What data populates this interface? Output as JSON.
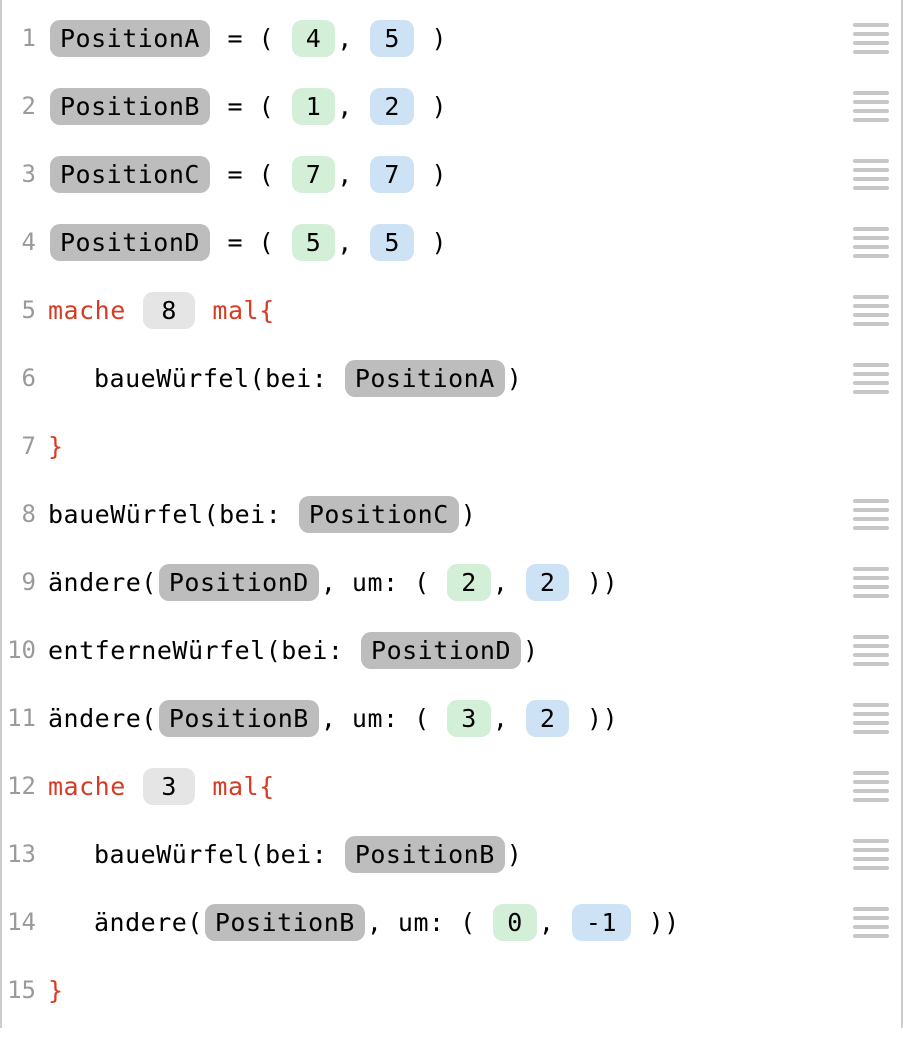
{
  "lines": [
    {
      "n": 1,
      "drag": true,
      "indent": 0,
      "tokens": [
        {
          "k": "var",
          "v": "PositionA"
        },
        {
          "k": "plain",
          "v": " = ( "
        },
        {
          "k": "pill",
          "c": "green",
          "v": "4"
        },
        {
          "k": "plain",
          "v": ", "
        },
        {
          "k": "pill",
          "c": "blue",
          "v": "5"
        },
        {
          "k": "plain",
          "v": " )"
        }
      ]
    },
    {
      "n": 2,
      "drag": true,
      "indent": 0,
      "tokens": [
        {
          "k": "var",
          "v": "PositionB"
        },
        {
          "k": "plain",
          "v": " = ( "
        },
        {
          "k": "pill",
          "c": "green",
          "v": "1"
        },
        {
          "k": "plain",
          "v": ", "
        },
        {
          "k": "pill",
          "c": "blue",
          "v": "2"
        },
        {
          "k": "plain",
          "v": " )"
        }
      ]
    },
    {
      "n": 3,
      "drag": true,
      "indent": 0,
      "tokens": [
        {
          "k": "var",
          "v": "PositionC"
        },
        {
          "k": "plain",
          "v": " = ( "
        },
        {
          "k": "pill",
          "c": "green",
          "v": "7"
        },
        {
          "k": "plain",
          "v": ", "
        },
        {
          "k": "pill",
          "c": "blue",
          "v": "7"
        },
        {
          "k": "plain",
          "v": " )"
        }
      ]
    },
    {
      "n": 4,
      "drag": true,
      "indent": 0,
      "tokens": [
        {
          "k": "var",
          "v": "PositionD"
        },
        {
          "k": "plain",
          "v": " = ( "
        },
        {
          "k": "pill",
          "c": "green",
          "v": "5"
        },
        {
          "k": "plain",
          "v": ", "
        },
        {
          "k": "pill",
          "c": "blue",
          "v": "5"
        },
        {
          "k": "plain",
          "v": " )"
        }
      ]
    },
    {
      "n": 5,
      "drag": true,
      "indent": 0,
      "tokens": [
        {
          "k": "kw",
          "v": "mache "
        },
        {
          "k": "pill",
          "c": "grey",
          "v": "8"
        },
        {
          "k": "kw",
          "v": " mal{"
        }
      ]
    },
    {
      "n": 6,
      "drag": true,
      "indent": 1,
      "tokens": [
        {
          "k": "plain",
          "v": "baueWürfel(bei: "
        },
        {
          "k": "var",
          "v": "PositionA"
        },
        {
          "k": "plain",
          "v": ")"
        }
      ]
    },
    {
      "n": 7,
      "drag": false,
      "indent": 0,
      "tokens": [
        {
          "k": "kw",
          "v": "}"
        }
      ]
    },
    {
      "n": 8,
      "drag": true,
      "indent": 0,
      "tokens": [
        {
          "k": "plain",
          "v": "baueWürfel(bei: "
        },
        {
          "k": "var",
          "v": "PositionC"
        },
        {
          "k": "plain",
          "v": ")"
        }
      ]
    },
    {
      "n": 9,
      "drag": true,
      "indent": 0,
      "tokens": [
        {
          "k": "plain",
          "v": "ändere("
        },
        {
          "k": "var",
          "v": "PositionD"
        },
        {
          "k": "plain",
          "v": ", um: ( "
        },
        {
          "k": "pill",
          "c": "green",
          "v": "2"
        },
        {
          "k": "plain",
          "v": ", "
        },
        {
          "k": "pill",
          "c": "blue",
          "v": "2"
        },
        {
          "k": "plain",
          "v": " ))"
        }
      ]
    },
    {
      "n": 10,
      "drag": true,
      "indent": 0,
      "tokens": [
        {
          "k": "plain",
          "v": "entferneWürfel(bei: "
        },
        {
          "k": "var",
          "v": "PositionD"
        },
        {
          "k": "plain",
          "v": ")"
        }
      ]
    },
    {
      "n": 11,
      "drag": true,
      "indent": 0,
      "tokens": [
        {
          "k": "plain",
          "v": "ändere("
        },
        {
          "k": "var",
          "v": "PositionB"
        },
        {
          "k": "plain",
          "v": ", um: ( "
        },
        {
          "k": "pill",
          "c": "green",
          "v": "3"
        },
        {
          "k": "plain",
          "v": ", "
        },
        {
          "k": "pill",
          "c": "blue",
          "v": "2"
        },
        {
          "k": "plain",
          "v": " ))"
        }
      ]
    },
    {
      "n": 12,
      "drag": true,
      "indent": 0,
      "tokens": [
        {
          "k": "kw",
          "v": "mache "
        },
        {
          "k": "pill",
          "c": "grey",
          "v": "3"
        },
        {
          "k": "kw",
          "v": " mal{"
        }
      ]
    },
    {
      "n": 13,
      "drag": true,
      "indent": 1,
      "tokens": [
        {
          "k": "plain",
          "v": "baueWürfel(bei: "
        },
        {
          "k": "var",
          "v": "PositionB"
        },
        {
          "k": "plain",
          "v": ")"
        }
      ]
    },
    {
      "n": 14,
      "drag": true,
      "indent": 1,
      "tokens": [
        {
          "k": "plain",
          "v": "ändere("
        },
        {
          "k": "var",
          "v": "PositionB"
        },
        {
          "k": "plain",
          "v": ", um: ( "
        },
        {
          "k": "pill",
          "c": "green",
          "v": "0"
        },
        {
          "k": "plain",
          "v": ", "
        },
        {
          "k": "pill",
          "c": "blue",
          "v": "-1"
        },
        {
          "k": "plain",
          "v": " ))"
        }
      ]
    },
    {
      "n": 15,
      "drag": false,
      "indent": 0,
      "tokens": [
        {
          "k": "kw",
          "v": "}"
        }
      ]
    }
  ]
}
